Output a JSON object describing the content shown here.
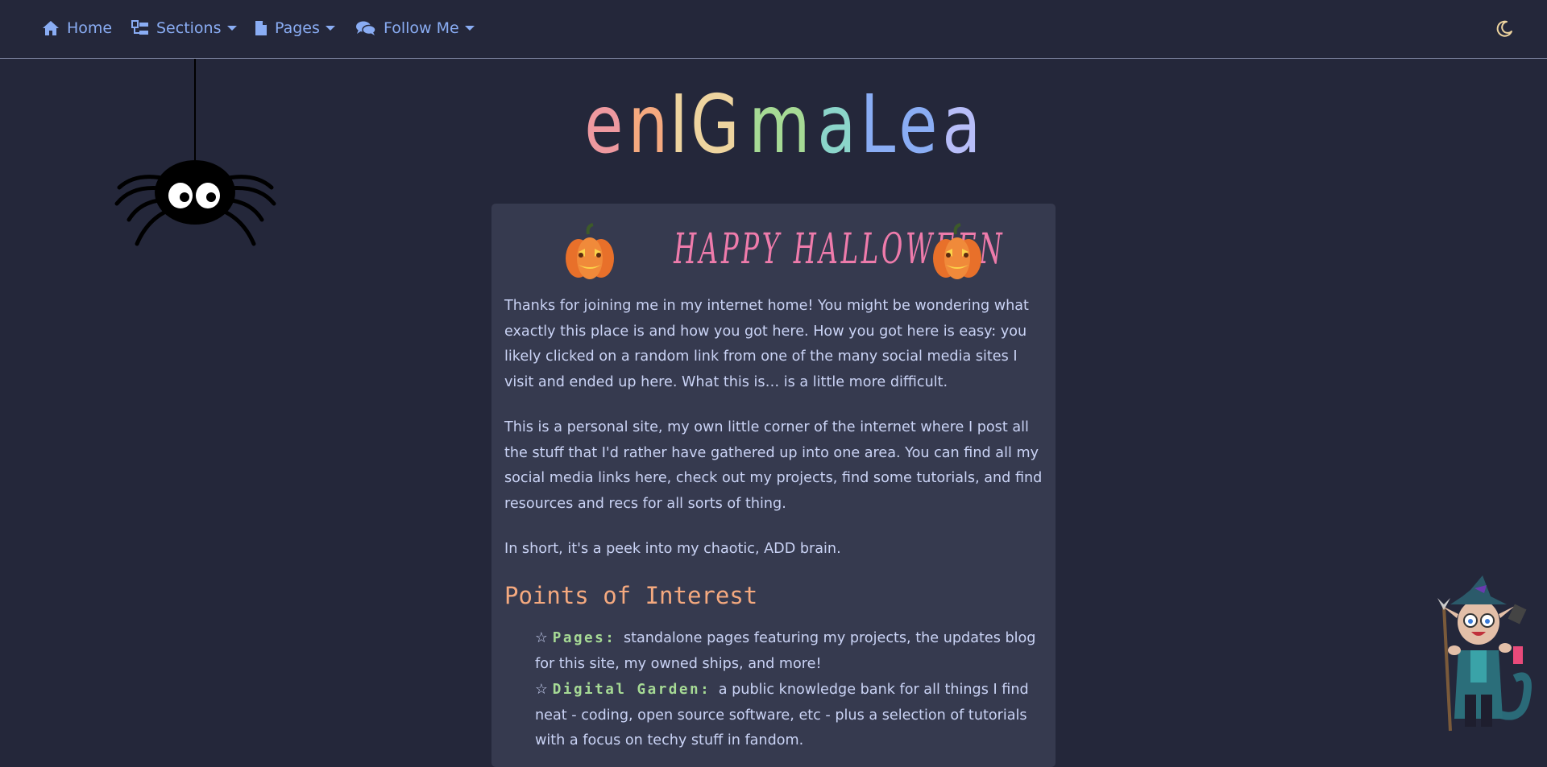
{
  "nav": {
    "items": [
      {
        "label": "Home",
        "icon": "home-icon"
      },
      {
        "label": "Sections",
        "icon": "sections-icon",
        "dropdown": true
      },
      {
        "label": "Pages",
        "icon": "file-icon",
        "dropdown": true
      },
      {
        "label": "Follow Me",
        "icon": "comments-icon",
        "dropdown": true
      }
    ],
    "theme_toggle_icon": "moon-icon"
  },
  "logo": {
    "letters": [
      "e",
      "n",
      "I",
      "G",
      "m",
      "a",
      "L",
      "e",
      "a"
    ],
    "colors": [
      "#ee99a0",
      "#f5a97f",
      "#eed49f",
      "#eed49f",
      "#a6da95",
      "#8bd5ca",
      "#8aadf4",
      "#8aadf4",
      "#b7bdf8"
    ]
  },
  "banner": {
    "text": "HAPPY HALLOWEEN",
    "left_icon": "pumpkin-icon",
    "right_icon": "pumpkin-icon"
  },
  "intro": {
    "p1": "Thanks for joining me in my internet home! You might be wondering what exactly this place is and how you got here. How you got here is easy: you likely clicked on a random link from one of the many social media sites I visit and ended up here. What this is… is a little more difficult.",
    "p2": "This is a personal site, my own little corner of the internet where I post all the stuff that I'd rather have gathered up into one area. You can find all my social media links here, check out my projects, find some tutorials, and find resources and recs for all sorts of thing.",
    "p3": "In short, it's a peek into my chaotic, ADD brain."
  },
  "points": {
    "heading": "Points of Interest",
    "items": [
      {
        "star": "☆",
        "key": "Pages:",
        "text": "standalone pages featuring my projects, the updates blog for this site, my owned ships, and more!"
      },
      {
        "star": "☆",
        "key": "Digital Garden:",
        "text": "a public knowledge bank for all things I find neat - coding, open source software, etc - plus a selection of tutorials with a focus on techy stuff in fandom."
      }
    ]
  },
  "colors": {
    "background": "#24273a",
    "card": "#363a4f",
    "link": "#8aadf4",
    "text": "#cad3f5",
    "heading": "#f5a97f",
    "key": "#a6da95",
    "halloween": "#ee7bab"
  }
}
